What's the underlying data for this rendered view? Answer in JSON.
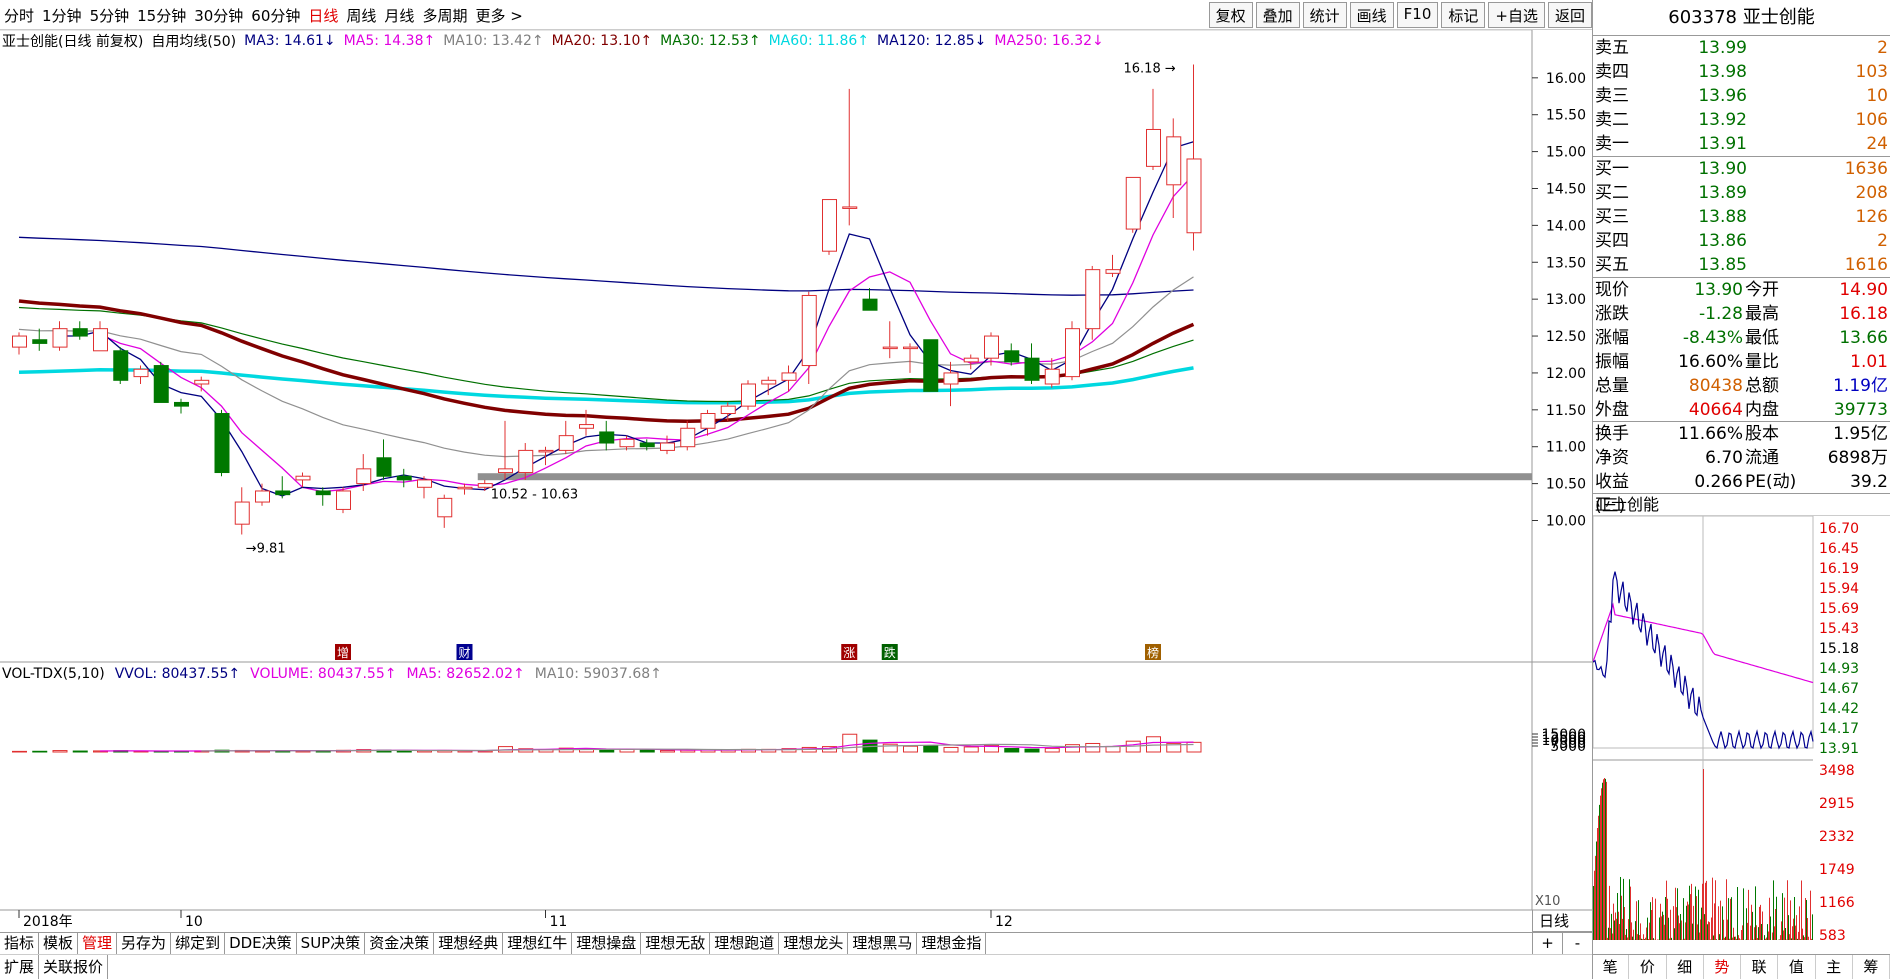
{
  "topbar": {
    "periods": [
      "分时",
      "1分钟",
      "5分钟",
      "15分钟",
      "30分钟",
      "60分钟",
      "日线",
      "周线",
      "月线",
      "多周期",
      "更多 >"
    ],
    "active_period": "日线",
    "tools": [
      "复权",
      "叠加",
      "统计",
      "画线",
      "F10",
      "标记",
      "+自选",
      "返回"
    ]
  },
  "stock": {
    "code": "603378",
    "name": "亚士创能"
  },
  "legend": {
    "title": "亚士创能(日线 前复权)",
    "indicator": "自用均线(50)",
    "ma": [
      {
        "label": "MA3: 14.61↓",
        "color": "#000080"
      },
      {
        "label": "MA5: 14.38↑",
        "color": "#e000e0"
      },
      {
        "label": "MA10: 13.42↑",
        "color": "#808080"
      },
      {
        "label": "MA20: 13.10↑",
        "color": "#800000"
      },
      {
        "label": "MA30: 12.53↑",
        "color": "#007000"
      },
      {
        "label": "MA60: 11.86↑",
        "color": "#00d8e0"
      },
      {
        "label": "MA120: 12.85↓",
        "color": "#000080"
      },
      {
        "label": "MA250: 16.32↓",
        "color": "#e000e0"
      }
    ]
  },
  "vol_legend": {
    "title": "VOL-TDX(5,10)",
    "items": [
      {
        "label": "VVOL: 80437.55↑",
        "color": "#000080"
      },
      {
        "label": "VOLUME: 80437.55↑",
        "color": "#e000e0"
      },
      {
        "label": "MA5: 82652.02↑",
        "color": "#e000e0"
      },
      {
        "label": "MA10: 59037.68↑",
        "color": "#808080"
      }
    ]
  },
  "annotations": {
    "high": "16.18",
    "low": "9.81",
    "range": "10.52 - 10.63",
    "vol_unit": "X10"
  },
  "event_markers": [
    {
      "label": "增",
      "color": "#a00000",
      "index": 16
    },
    {
      "label": "财",
      "color": "#000090",
      "index": 22
    },
    {
      "label": "涨",
      "color": "#a00000",
      "index": 41
    },
    {
      "label": "跌",
      "color": "#006000",
      "index": 43
    },
    {
      "label": "榜",
      "color": "#a06000",
      "index": 56
    }
  ],
  "x_labels": [
    {
      "label": "2018年",
      "index": 0
    },
    {
      "label": "10",
      "index": 8
    },
    {
      "label": "11",
      "index": 26
    },
    {
      "label": "12",
      "index": 48
    }
  ],
  "chart_data": {
    "type": "candlestick",
    "price_ticks": [
      10.0,
      10.5,
      11.0,
      11.5,
      12.0,
      12.5,
      13.0,
      13.5,
      14.0,
      14.5,
      15.0,
      15.5,
      16.0
    ],
    "vol_ticks": [
      5000,
      7500,
      10000,
      12500,
      15000
    ],
    "ylim": [
      9.6,
      16.35
    ],
    "vol_ylim": [
      0,
      16000
    ],
    "candles": [
      [
        12.35,
        12.55,
        12.25,
        12.5,
        520
      ],
      [
        12.45,
        12.6,
        12.3,
        12.4,
        600
      ],
      [
        12.35,
        12.7,
        12.3,
        12.6,
        1200
      ],
      [
        12.6,
        12.7,
        12.45,
        12.5,
        800
      ],
      [
        12.3,
        12.7,
        12.3,
        12.6,
        900
      ],
      [
        12.3,
        12.35,
        11.85,
        11.9,
        1100
      ],
      [
        11.95,
        12.1,
        11.85,
        12.05,
        600
      ],
      [
        12.1,
        12.15,
        11.6,
        11.6,
        800
      ],
      [
        11.6,
        11.65,
        11.45,
        11.55,
        700
      ],
      [
        11.85,
        11.95,
        11.75,
        11.9,
        900
      ],
      [
        11.45,
        11.5,
        10.6,
        10.65,
        1500
      ],
      [
        9.95,
        10.45,
        9.81,
        10.25,
        1300
      ],
      [
        10.25,
        10.5,
        10.2,
        10.4,
        1000
      ],
      [
        10.4,
        10.6,
        10.3,
        10.35,
        1000
      ],
      [
        10.55,
        10.65,
        10.45,
        10.6,
        1100
      ],
      [
        10.4,
        10.45,
        10.2,
        10.35,
        1200
      ],
      [
        10.15,
        10.45,
        10.1,
        10.4,
        1400
      ],
      [
        10.5,
        10.9,
        10.4,
        10.7,
        2000
      ],
      [
        10.85,
        11.1,
        10.55,
        10.6,
        1500
      ],
      [
        10.6,
        10.7,
        10.45,
        10.55,
        1200
      ],
      [
        10.45,
        10.6,
        10.3,
        10.55,
        1100
      ],
      [
        10.05,
        10.35,
        9.9,
        10.3,
        1300
      ],
      [
        10.45,
        10.5,
        10.35,
        10.45,
        1100
      ],
      [
        10.45,
        10.55,
        10.4,
        10.5,
        1000
      ],
      [
        10.65,
        11.35,
        10.55,
        10.7,
        4500
      ],
      [
        10.65,
        11.05,
        10.55,
        10.95,
        2700
      ],
      [
        10.95,
        11.0,
        10.75,
        10.95,
        2000
      ],
      [
        10.95,
        11.35,
        10.9,
        11.15,
        3200
      ],
      [
        11.25,
        11.5,
        11.15,
        11.3,
        2800
      ],
      [
        11.2,
        11.35,
        10.95,
        11.05,
        2000
      ],
      [
        11.0,
        11.15,
        10.95,
        11.1,
        2200
      ],
      [
        11.05,
        11.1,
        10.95,
        11.0,
        1600
      ],
      [
        10.95,
        11.15,
        10.9,
        11.05,
        1200
      ],
      [
        11.0,
        11.35,
        10.95,
        11.25,
        1500
      ],
      [
        11.25,
        11.5,
        11.15,
        11.45,
        2000
      ],
      [
        11.45,
        11.6,
        11.35,
        11.55,
        1800
      ],
      [
        11.55,
        11.9,
        11.5,
        11.85,
        2200
      ],
      [
        11.85,
        11.95,
        11.7,
        11.9,
        2200
      ],
      [
        11.9,
        12.1,
        11.75,
        12.0,
        2800
      ],
      [
        12.1,
        13.1,
        11.85,
        13.05,
        3800
      ],
      [
        13.65,
        14.3,
        13.6,
        14.35,
        4500
      ],
      [
        14.25,
        15.85,
        14.0,
        14.25,
        14800
      ],
      [
        13.0,
        13.15,
        12.85,
        12.85,
        9900
      ],
      [
        12.35,
        12.7,
        12.2,
        12.35,
        6500
      ],
      [
        12.35,
        12.4,
        12.0,
        12.35,
        4800
      ],
      [
        12.45,
        12.45,
        11.75,
        11.75,
        5200
      ],
      [
        11.85,
        12.15,
        11.55,
        12.0,
        3800
      ],
      [
        12.15,
        12.25,
        12.05,
        12.2,
        4200
      ],
      [
        12.2,
        12.55,
        12.1,
        12.5,
        5500
      ],
      [
        12.3,
        12.4,
        12.1,
        12.15,
        2900
      ],
      [
        12.2,
        12.4,
        11.85,
        11.9,
        2400
      ],
      [
        11.85,
        12.2,
        11.8,
        12.05,
        3000
      ],
      [
        11.95,
        12.7,
        11.9,
        12.6,
        6100
      ],
      [
        12.6,
        13.45,
        12.45,
        13.4,
        7100
      ],
      [
        13.35,
        13.6,
        13.3,
        13.4,
        4600
      ],
      [
        13.95,
        14.65,
        13.9,
        14.65,
        9000
      ],
      [
        14.8,
        15.85,
        14.75,
        15.3,
        12700
      ],
      [
        14.55,
        15.45,
        14.1,
        15.2,
        7000
      ],
      [
        13.9,
        16.18,
        13.66,
        14.9,
        8044
      ]
    ]
  },
  "order_book": {
    "asks": [
      {
        "label": "卖五",
        "price": "13.99",
        "vol": "2"
      },
      {
        "label": "卖四",
        "price": "13.98",
        "vol": "103"
      },
      {
        "label": "卖三",
        "price": "13.96",
        "vol": "10"
      },
      {
        "label": "卖二",
        "price": "13.92",
        "vol": "106"
      },
      {
        "label": "卖一",
        "price": "13.91",
        "vol": "24"
      }
    ],
    "bids": [
      {
        "label": "买一",
        "price": "13.90",
        "vol": "1636"
      },
      {
        "label": "买二",
        "price": "13.89",
        "vol": "208"
      },
      {
        "label": "买三",
        "price": "13.88",
        "vol": "126"
      },
      {
        "label": "买四",
        "price": "13.86",
        "vol": "2"
      },
      {
        "label": "买五",
        "price": "13.85",
        "vol": "1616"
      }
    ]
  },
  "stats": [
    [
      {
        "k": "现价",
        "v": "13.90",
        "c": "green"
      },
      {
        "k": "今开",
        "v": "14.90",
        "c": "red"
      }
    ],
    [
      {
        "k": "涨跌",
        "v": "-1.28",
        "c": "green"
      },
      {
        "k": "最高",
        "v": "16.18",
        "c": "red"
      }
    ],
    [
      {
        "k": "涨幅",
        "v": "-8.43%",
        "c": "green"
      },
      {
        "k": "最低",
        "v": "13.66",
        "c": "green"
      }
    ],
    [
      {
        "k": "振幅",
        "v": "16.60%",
        "c": ""
      },
      {
        "k": "量比",
        "v": "1.01",
        "c": "red"
      }
    ],
    [
      {
        "k": "总量",
        "v": "80438",
        "c": "orange"
      },
      {
        "k": "总额",
        "v": "1.19亿",
        "c": "blue"
      }
    ],
    [
      {
        "k": "外盘",
        "v": "40664",
        "c": "red"
      },
      {
        "k": "内盘",
        "v": "39773",
        "c": "green"
      }
    ],
    [
      {
        "k": "换手",
        "v": "11.66%",
        "c": ""
      },
      {
        "k": "股本",
        "v": "1.95亿",
        "c": ""
      }
    ],
    [
      {
        "k": "净资",
        "v": "6.70",
        "c": ""
      },
      {
        "k": "流通",
        "v": "6898万",
        "c": ""
      }
    ],
    [
      {
        "k": "收益(三)",
        "v": "0.266",
        "c": ""
      },
      {
        "k": "PE(动)",
        "v": "39.2",
        "c": ""
      }
    ]
  ],
  "mini_chart": {
    "title": "亚士创能",
    "price_ticks": [
      "16.70",
      "16.45",
      "16.19",
      "15.94",
      "15.69",
      "15.43",
      "15.18",
      "14.93",
      "14.67",
      "14.42",
      "14.17",
      "13.91"
    ],
    "vol_ticks": [
      "3498",
      "2915",
      "2332",
      "1749",
      "1166",
      "583"
    ]
  },
  "bottom_tabs": [
    "指标",
    "模板",
    "管理",
    "另存为",
    "绑定到",
    "DDE决策",
    "SUP决策",
    "资金决策",
    "理想经典",
    "理想红牛",
    "理想操盘",
    "理想无敌",
    "理想跑道",
    "理想龙头",
    "理想黑马",
    "理想金指"
  ],
  "active_bottom_tab": "管理",
  "ext_tabs": [
    "扩展",
    "关联报价"
  ],
  "period_box": {
    "label": "日线",
    "plus": "+",
    "minus": "-"
  },
  "right_tabs": [
    "笔",
    "价",
    "细",
    "势",
    "联",
    "值",
    "主",
    "筹"
  ],
  "active_right_tab": "势"
}
